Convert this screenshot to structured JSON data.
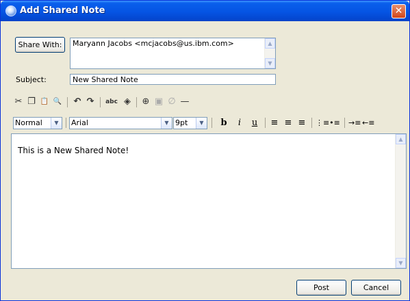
{
  "window": {
    "title": "Add Shared Note",
    "close_glyph": "✕"
  },
  "form": {
    "share_with_label": "Share With:",
    "recipients_value": "Maryann Jacobs <mcjacobs@us.ibm.com>",
    "subject_label": "Subject:",
    "subject_value": "New Shared Note"
  },
  "toolbar_edit": [
    {
      "name": "cut-icon",
      "glyph": "✂"
    },
    {
      "name": "copy-icon",
      "glyph": "❐"
    },
    {
      "name": "paste-icon",
      "glyph": "📋"
    },
    {
      "name": "find-icon",
      "glyph": "🔍"
    },
    {
      "name": "undo-icon",
      "glyph": "↶"
    },
    {
      "name": "redo-icon",
      "glyph": "↷"
    },
    {
      "name": "spellcheck-icon",
      "glyph": "abc"
    },
    {
      "name": "fill-color-icon",
      "glyph": "◈"
    },
    {
      "name": "insert-link-icon",
      "glyph": "⊕"
    },
    {
      "name": "insert-image-icon",
      "glyph": "▣"
    },
    {
      "name": "attach-icon",
      "glyph": "∅"
    },
    {
      "name": "horizontal-rule-icon",
      "glyph": "—"
    }
  ],
  "formatting": {
    "paragraph_style": "Normal",
    "font_family": "Arial",
    "font_size": "9pt",
    "bold": "b",
    "italic": "i",
    "underline": "u"
  },
  "editor": {
    "body_text": "This is a New Shared Note!"
  },
  "buttons": {
    "post_label": "Post",
    "cancel_label": "Cancel"
  },
  "colors": {
    "title_bar": "#0554E3",
    "window_bg": "#ECE9D8",
    "close_button": "#D2451A"
  }
}
